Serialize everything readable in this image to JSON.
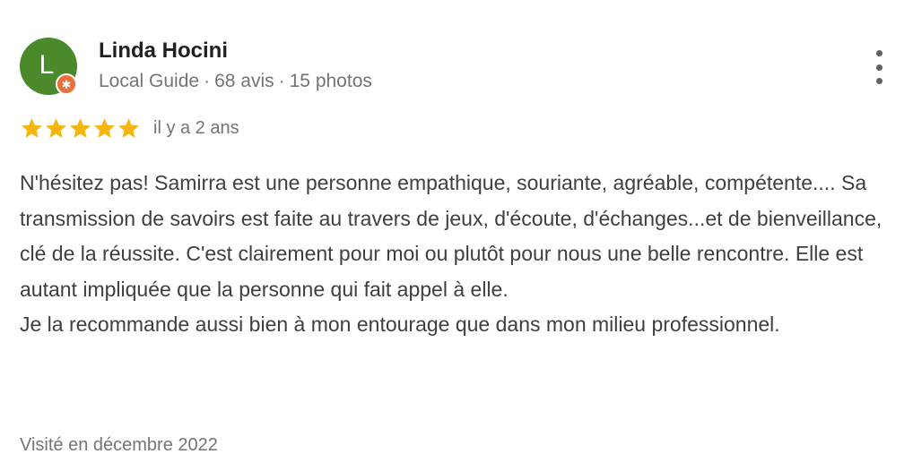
{
  "reviewer": {
    "name": "Linda Hocini",
    "avatar_letter": "L",
    "badge_icon": "local-guide-star-icon",
    "role": "Local Guide",
    "reviews_count": "68 avis",
    "photos_count": "15 photos",
    "separator": "·"
  },
  "rating": {
    "stars": 5,
    "max_stars": 5,
    "star_color": "#f6b60f",
    "time_ago": "il y a 2 ans"
  },
  "review": {
    "text": "N'hésitez pas! Samirra est une personne empathique, souriante, agréable, compétente.... Sa transmission de savoirs est faite au travers de jeux, d'écoute, d'échanges...et de bienveillance, clé de la réussite. C'est clairement pour moi ou plutôt pour nous une belle rencontre. Elle est autant impliquée que la personne qui fait appel à elle.\nJe la recommande aussi bien à mon entourage que dans mon milieu professionnel.",
    "visited": "Visité en décembre 2022"
  },
  "menu": {
    "icon": "more-vert-icon"
  },
  "colors": {
    "avatar_bg": "#4a8a2a",
    "badge_bg": "#e8703a",
    "secondary_text": "#70757a"
  }
}
